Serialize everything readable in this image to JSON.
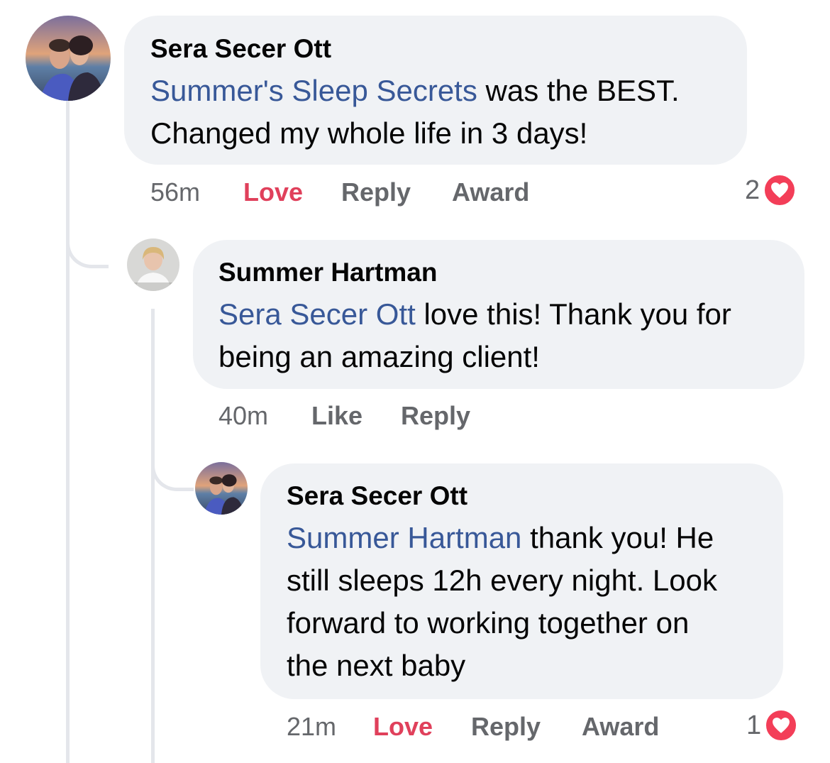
{
  "comments": [
    {
      "author": "Sera Secer Ott",
      "mention": "Summer's Sleep Secrets",
      "text_line1": " was the BEST.",
      "text_line2": "Changed my whole life in 3 days!",
      "time": "56m",
      "love_label": "Love",
      "reply_label": "Reply",
      "award_label": "Award",
      "reaction_count": "2"
    },
    {
      "author": "Summer Hartman",
      "mention": "Sera Secer Ott",
      "text_line1": " love this! Thank you for",
      "text_line2": "being an amazing client!",
      "time": "40m",
      "like_label": "Like",
      "reply_label": "Reply"
    },
    {
      "author": "Sera Secer Ott",
      "mention": "Summer Hartman",
      "text_line1": " thank you! He",
      "text_line2": "still sleeps 12h every night. Look",
      "text_line3": "forward to working together on",
      "text_line4": "the next baby",
      "time": "21m",
      "love_label": "Love",
      "reply_label": "Reply",
      "award_label": "Award",
      "reaction_count": "1"
    }
  ],
  "icons": {
    "reaction": "heart-icon"
  },
  "colors": {
    "mention": "#385898",
    "love": "#e0405b",
    "bubble": "#f0f2f5",
    "heart": "#f33e58"
  }
}
